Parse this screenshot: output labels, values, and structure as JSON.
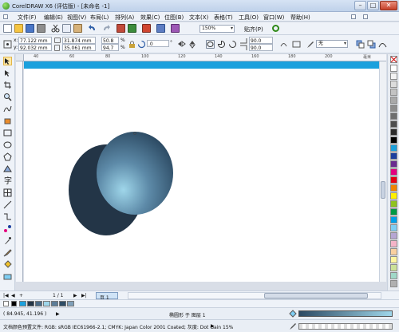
{
  "window": {
    "title": "CorelDRAW X6 (评估版) - [未命名 -1]"
  },
  "menu": [
    "文件(F)",
    "编辑(E)",
    "视图(V)",
    "布局(L)",
    "排列(A)",
    "效果(C)",
    "位图(B)",
    "文本(X)",
    "表格(T)",
    "工具(O)",
    "窗口(W)",
    "帮助(H)"
  ],
  "toolbar": {
    "zoom": "150%",
    "snap_label": "贴齐(P)"
  },
  "properties": {
    "x_label": "x:",
    "x_value": "77.122 mm",
    "y_label": "y:",
    "y_value": "92.032 mm",
    "width_value": "31.874 mm",
    "height_value": "35.061 mm",
    "scale_x": "50.8",
    "scale_y": "94.7",
    "percent": "%",
    "rotation": ".0",
    "degree_symbol": "°",
    "angle1": "90.0",
    "angle2": "90.0",
    "outline": "无"
  },
  "ruler": {
    "labels": [
      "40",
      "60",
      "80",
      "100",
      "120",
      "140",
      "160",
      "180",
      "200"
    ],
    "unit": "毫米"
  },
  "pagebar": {
    "page_counter": "1 / 1",
    "page_tab": "页 1"
  },
  "status": {
    "coords": "( 84.945, 41.196 )",
    "object_info": "椭圆形 于 图层 1",
    "color_profile": "文档颜色预置文件: RGB: sRGB IEC61966-2.1; CMYK: Japan Color 2001 Coated; 灰度: Dot Gain 15%"
  },
  "colors": {
    "accent": "#1ba0dd",
    "ellipse_dark": "#233547",
    "ellipse_light_center": "#9fd6ea",
    "ellipse_light_edge": "#2c4a63"
  },
  "palette_colors": [
    "#ffffff",
    "#f2f2f2",
    "#dcdcdc",
    "#c3c3c3",
    "#a9a9a9",
    "#8c8c8c",
    "#6e6e6e",
    "#4d4d4d",
    "#2b2b2b",
    "#000000",
    "#1aa0dc",
    "#1d3f9e",
    "#6a2c90",
    "#e4007f",
    "#e60012",
    "#f08300",
    "#fff100",
    "#8fc31f",
    "#009944",
    "#00a0e9",
    "#7ecef4",
    "#b6a6d3",
    "#f4b4c8",
    "#f9d0a0",
    "#fff6a0",
    "#cce198",
    "#a0d8c8",
    "#b0b0b0"
  ],
  "doc_palette_colors": [
    "#1ba0dd",
    "#233547",
    "#4a6a86",
    "#9fd6ea",
    "#5d7d98",
    "#2f4d66",
    "#7f9fb8"
  ]
}
